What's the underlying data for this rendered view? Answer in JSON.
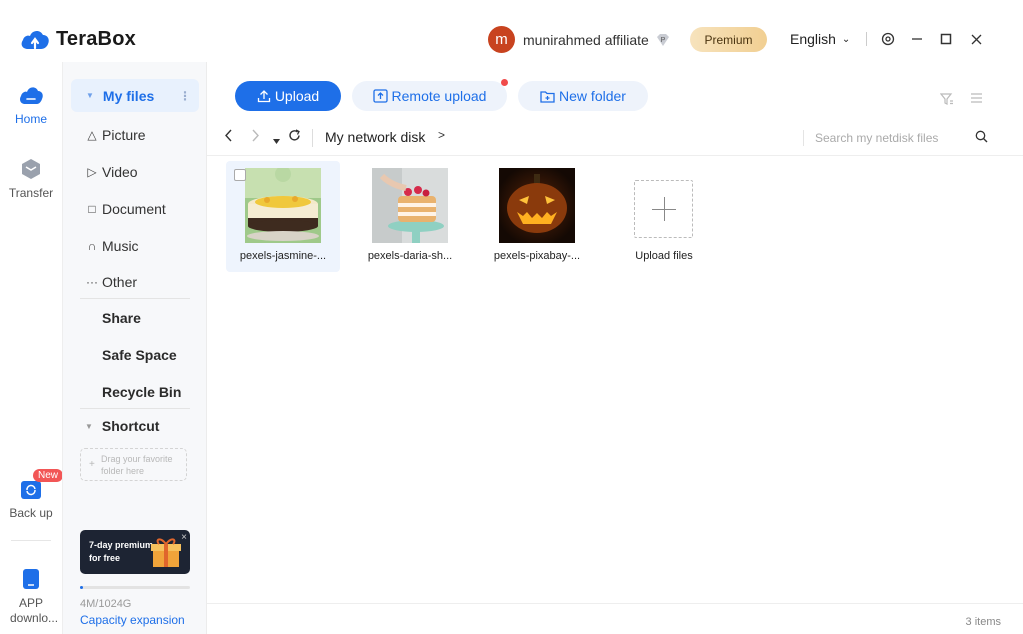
{
  "app": {
    "name": "TeraBox"
  },
  "user": {
    "initial": "m",
    "name": "munirahmed affiliate"
  },
  "titlebar": {
    "premium_label": "Premium",
    "language": "English"
  },
  "rail": {
    "items": [
      {
        "label": "Home"
      },
      {
        "label": "Transfer"
      },
      {
        "label": "Back up",
        "badge": "New"
      },
      {
        "label": "APP downlo..."
      }
    ]
  },
  "sidebar": {
    "my_files": "My files",
    "categories": [
      {
        "label": "Picture",
        "icon": "picture-icon"
      },
      {
        "label": "Video",
        "icon": "video-icon"
      },
      {
        "label": "Document",
        "icon": "document-icon"
      },
      {
        "label": "Music",
        "icon": "music-icon"
      },
      {
        "label": "Other",
        "icon": "other-icon"
      }
    ],
    "sections": [
      "Share",
      "Safe Space",
      "Recycle Bin"
    ],
    "shortcut": "Shortcut",
    "drag_hint_line1": "Drag your favorite",
    "drag_hint_line2": "folder here",
    "promo_line1": "7-day premium",
    "promo_line2": "for free",
    "storage_used_text": "4M/1024G",
    "storage_used_fraction": 0.004,
    "capacity_link": "Capacity expansion"
  },
  "toolbar": {
    "upload": "Upload",
    "remote_upload": "Remote upload",
    "new_folder": "New folder"
  },
  "path": {
    "crumb": "My network disk",
    "search_placeholder": "Search my netdisk files"
  },
  "files": [
    {
      "name": "pexels-jasmine-..."
    },
    {
      "name": "pexels-daria-sh..."
    },
    {
      "name": "pexels-pixabay-..."
    }
  ],
  "upload_tile_label": "Upload files",
  "status": {
    "items": "3 items"
  },
  "colors": {
    "accent": "#1e6fe8",
    "premium": "#f1cf92",
    "badge": "#f25656"
  }
}
